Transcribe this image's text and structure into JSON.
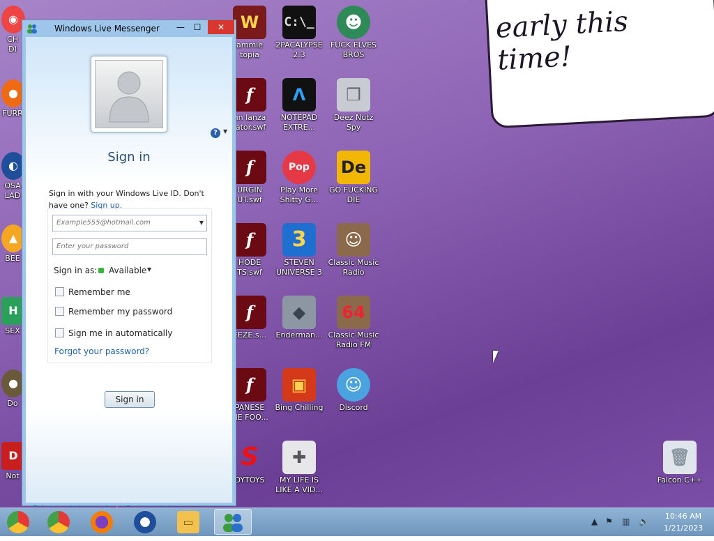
{
  "colors": {
    "wallpaper_start": "#a784c8",
    "wallpaper_end": "#6b3f95",
    "messenger_accent": "#2263a5",
    "close_button": "#d9372e",
    "taskbar": "#7da4c8"
  },
  "wallpaper": {
    "speech_text": "early this\ntime!"
  },
  "desktop_icons": [
    {
      "label": "",
      "icon": "chrome-icon"
    },
    {
      "label": "",
      "icon": "visual-studio-icon"
    },
    {
      "label": "",
      "icon": "app-icon"
    },
    {
      "label": "",
      "icon": "app-icon"
    },
    {
      "label": "ammie\ntopia",
      "icon": "game-icon"
    },
    {
      "label": "2PACALYPSE\n2.3",
      "icon": "terminal-icon"
    },
    {
      "label": "FUCK ELVES\nBROS",
      "icon": "game-icon"
    },
    {
      "label": "nn lanza\nlator.swf",
      "icon": "flash-icon"
    },
    {
      "label": "NOTEPAD\nEXTRE...",
      "icon": "notepad-icon"
    },
    {
      "label": "Deez Nutz\nSpy",
      "icon": "windows-stack-icon"
    },
    {
      "label": "URGIN\nUT.swf",
      "icon": "flash-icon"
    },
    {
      "label": "Play More\nShitty G...",
      "icon": "popcap-icon"
    },
    {
      "label": "GO FUCKING\nDIE",
      "icon": "die-icon"
    },
    {
      "label": "HODE\nTS.swf",
      "icon": "flash-icon"
    },
    {
      "label": "STEVEN\nUNIVERSE 3",
      "icon": "number-three-icon"
    },
    {
      "label": "Classic Music\nRadio",
      "icon": "portrait-icon"
    },
    {
      "label": "EEZE.s...",
      "icon": "flash-icon"
    },
    {
      "label": "Enderman...",
      "icon": "minecraft-block-icon"
    },
    {
      "label": "Classic Music\nRadio FM",
      "icon": "portrait-64-icon"
    },
    {
      "label": "PANESE\nME FOO...",
      "icon": "flash-icon"
    },
    {
      "label": "Bing Chilling",
      "icon": "game-box-icon"
    },
    {
      "label": "Discord",
      "icon": "messenger-people-icon"
    },
    {
      "label": "DYTOYS",
      "icon": "s-logo-icon"
    },
    {
      "label": "MY LIFE IS\nLIKE A VID...",
      "icon": "gamepad-icon"
    },
    {
      "label": "Falcon C++",
      "icon": "recycle-bin-icon"
    }
  ],
  "left_edge_icons": [
    {
      "label": "CH\nDI"
    },
    {
      "label": "FURR"
    },
    {
      "label": "OSA\nLAD"
    },
    {
      "label": "BEE"
    },
    {
      "label": "SEX"
    },
    {
      "label": "Do"
    },
    {
      "label": "Not"
    }
  ],
  "messenger": {
    "window_title": "Windows Live Messenger",
    "minimize": "—",
    "maximize": "☐",
    "close": "✕",
    "heading": "Sign in",
    "description": "Sign in with your Windows Live ID. Don't have one?",
    "signup_link": "Sign up.",
    "email_placeholder": "Example555@hotmail.com",
    "password_placeholder": "Enter your password",
    "status_label": "Sign in as:",
    "status_value": "Available",
    "remember_me": "Remember me",
    "remember_password": "Remember my password",
    "sign_in_auto": "Sign me in automatically",
    "forgot_password": "Forgot your password?",
    "signin_button": "Sign in",
    "privacy_link": "Privacy statement",
    "server_status_link": "Server status"
  },
  "taskbar": {
    "clock_time": "10:46 AM",
    "clock_date": "1/21/2023",
    "pinned": [
      "chrome-alt-icon",
      "chrome-icon",
      "firefox-icon",
      "obama-logo-icon",
      "file-explorer-icon",
      "messenger-icon"
    ]
  }
}
